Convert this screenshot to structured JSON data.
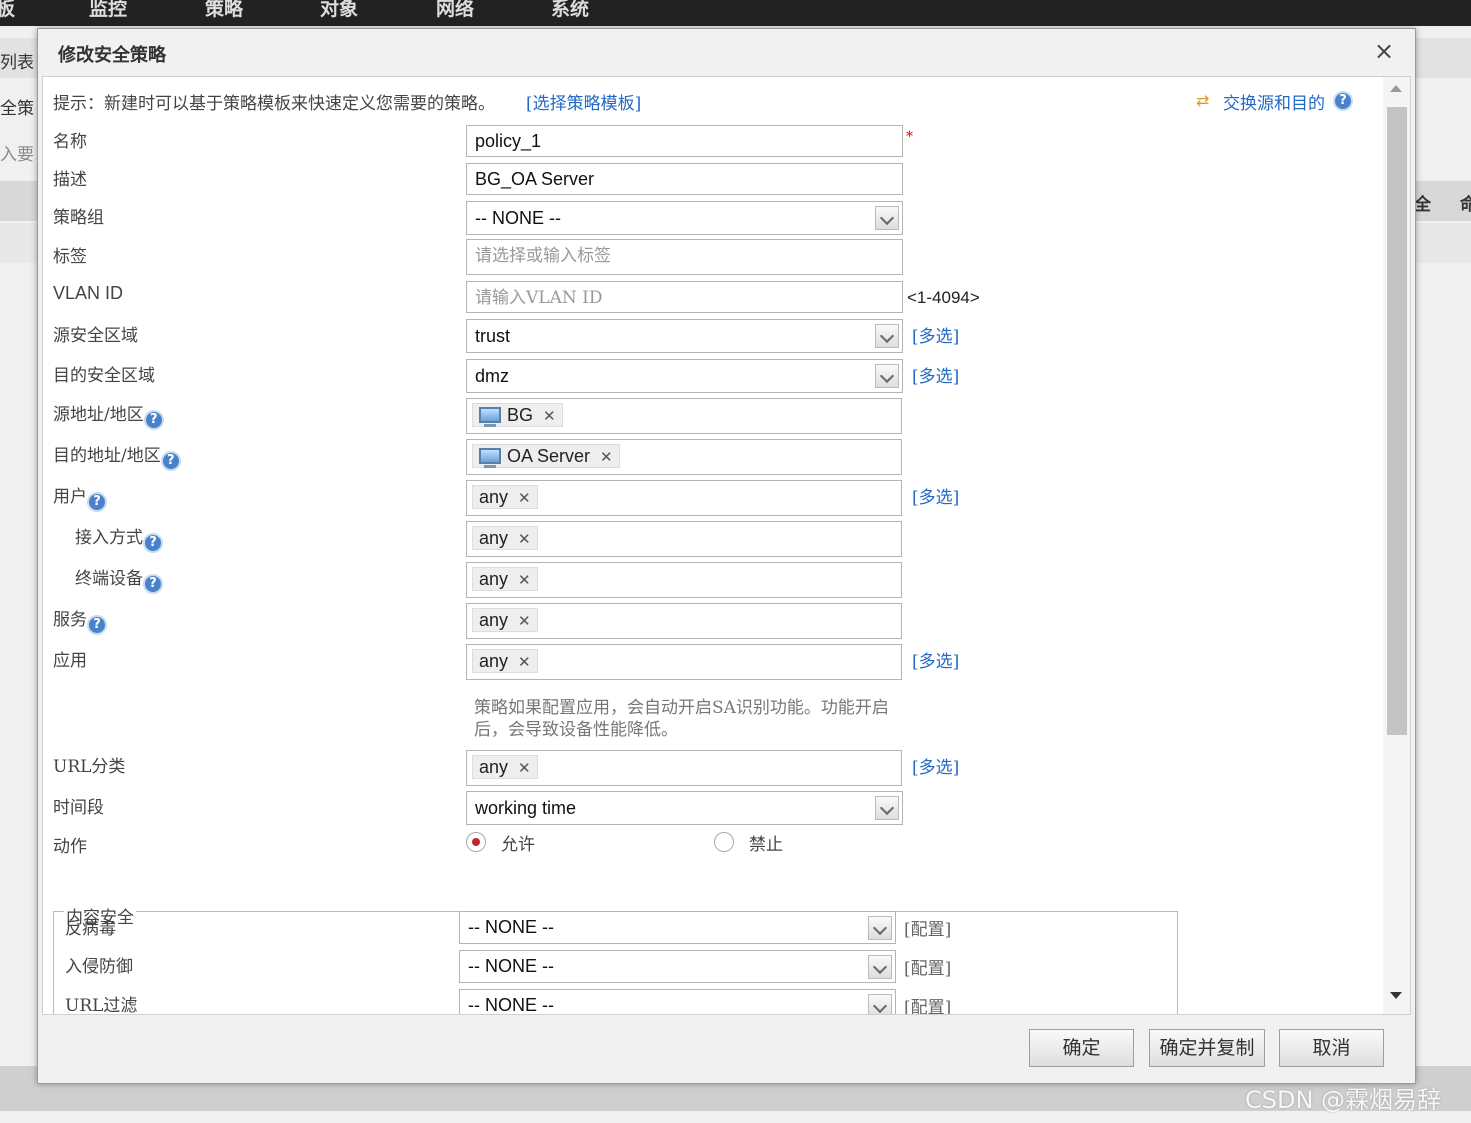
{
  "background": {
    "nav": [
      "板",
      "监控",
      "策略",
      "对象",
      "网络",
      "系统"
    ],
    "left_fragments": [
      "列表",
      "全策",
      "入要"
    ],
    "right_fragments": [
      "全",
      "命"
    ]
  },
  "dialog": {
    "title": "修改安全策略",
    "close": "×",
    "hint": "提示：新建时可以基于策略模板来快速定义您需要的策略。",
    "template_link": "[选择策略模板]",
    "swap_link": "交换源和目的"
  },
  "form": {
    "name": {
      "label": "名称",
      "value": "policy_1",
      "required": "*"
    },
    "description": {
      "label": "描述",
      "value": "BG_OA Server"
    },
    "policy_group": {
      "label": "策略组",
      "value": "-- NONE --"
    },
    "tag": {
      "label": "标签",
      "placeholder": "请选择或输入标签"
    },
    "vlan": {
      "label": "VLAN ID",
      "placeholder": "请输入VLAN ID",
      "range": "<1-4094>"
    },
    "src_zone": {
      "label": "源安全区域",
      "value": "trust"
    },
    "dst_zone": {
      "label": "目的安全区域",
      "value": "dmz"
    },
    "src_addr": {
      "label": "源地址/地区",
      "chip": "BG"
    },
    "dst_addr": {
      "label": "目的地址/地区",
      "chip": "OA Server"
    },
    "user": {
      "label": "用户",
      "chip": "any"
    },
    "access": {
      "label": "接入方式",
      "chip": "any"
    },
    "terminal": {
      "label": "终端设备",
      "chip": "any"
    },
    "service": {
      "label": "服务",
      "chip": "any"
    },
    "application": {
      "label": "应用",
      "chip": "any",
      "note1": "策略如果配置应用，会自动开启SA识别功能。功能开启",
      "note2": "后，会导致设备性能降低。"
    },
    "url_category": {
      "label": "URL分类",
      "chip": "any"
    },
    "schedule": {
      "label": "时间段",
      "value": "working time"
    },
    "action": {
      "label": "动作",
      "permit": "允许",
      "deny": "禁止"
    },
    "multi_select": "[多选]",
    "help": "?"
  },
  "content_security": {
    "legend": "内容安全",
    "rows": [
      {
        "label": "反病毒",
        "value": "-- NONE --",
        "config": "[配置]"
      },
      {
        "label": "入侵防御",
        "value": "-- NONE --",
        "config": "[配置]"
      },
      {
        "label": "URL过滤",
        "value": "-- NONE --",
        "config": "[配置]"
      }
    ]
  },
  "buttons": {
    "ok": "确定",
    "ok_copy": "确定并复制",
    "cancel": "取消"
  },
  "watermark": "CSDN @霖烟易辞",
  "colors": {
    "link": "#2369c6",
    "required": "#dd0000",
    "radio_selected": "#c2272d"
  }
}
